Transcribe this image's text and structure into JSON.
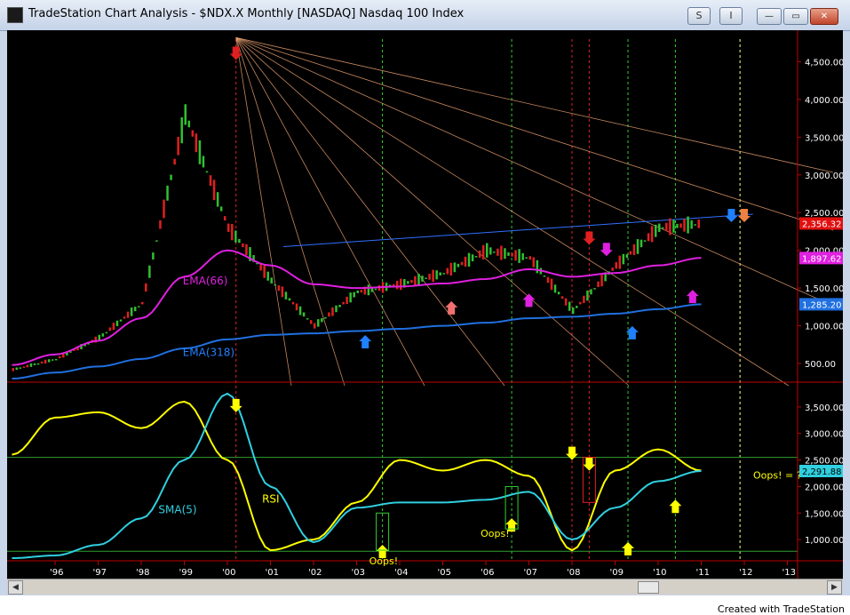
{
  "window": {
    "title": "TradeStation Chart Analysis - $NDX.X Monthly [NASDAQ] Nasdaq 100 Index",
    "s_button": "S",
    "i_button": "I",
    "minimize": "—",
    "maximize": "▭",
    "close": "✕"
  },
  "price_panel": {
    "y_ticks": [
      "4,500.00",
      "4,000.00",
      "3,500.00",
      "3,000.00",
      "2,500.00",
      "2,000.00",
      "1,500.00",
      "1,000.00",
      "500.00"
    ],
    "badges": [
      {
        "label": "2,356.32",
        "color": "#e01010"
      },
      {
        "label": "1,897.62",
        "color": "#e020e0"
      },
      {
        "label": "1,285.20",
        "color": "#2070e0"
      }
    ],
    "ema66_label": "EMA(66)",
    "ema318_label": "EMA(318)"
  },
  "indicator_panel": {
    "y_ticks": [
      "3,500.00",
      "3,000.00",
      "2,500.00",
      "2,000.00",
      "1,500.00",
      "1,000.00"
    ],
    "badge": {
      "label": "2,291.88",
      "color": "#30d0e0"
    },
    "rsi_label": "RSI",
    "sma_label": "SMA(5)",
    "annotations": [
      "Oops!",
      "Oops!",
      "Oops! = ?"
    ]
  },
  "x_axis": {
    "labels": [
      "'96",
      "'97",
      "'98",
      "'99",
      "'00",
      "'01",
      "'02",
      "'03",
      "'04",
      "'05",
      "'06",
      "'07",
      "'08",
      "'09",
      "'10",
      "'11",
      "'12",
      "'13"
    ]
  },
  "chart_data": {
    "type": "line",
    "instrument": "$NDX.X",
    "interval": "Monthly",
    "price_axis_range": [
      300,
      4800
    ],
    "x": [
      "'96",
      "'97",
      "'98",
      "'99",
      "'00",
      "'01",
      "'02",
      "'03",
      "'04",
      "'05",
      "'06",
      "'07",
      "'08",
      "'09",
      "'10",
      "'11",
      "'12"
    ],
    "series": [
      {
        "name": "EMA(66)",
        "color": "#e020e0",
        "values": [
          480,
          620,
          800,
          1100,
          1650,
          2000,
          1800,
          1550,
          1500,
          1520,
          1560,
          1620,
          1750,
          1650,
          1700,
          1800,
          1900
        ]
      },
      {
        "name": "EMA(318)",
        "color": "#2070e0",
        "values": [
          300,
          380,
          460,
          560,
          700,
          820,
          880,
          900,
          930,
          960,
          1000,
          1040,
          1100,
          1120,
          1160,
          1220,
          1285
        ]
      },
      {
        "name": "Price",
        "color": "#30c030",
        "values": [
          420,
          560,
          840,
          1300,
          3800,
          2300,
          1600,
          1000,
          1450,
          1550,
          1700,
          2000,
          1900,
          1200,
          1800,
          2300,
          2356
        ]
      }
    ],
    "indicator": {
      "axis_range": [
        600,
        3900
      ],
      "series": [
        {
          "name": "RSI",
          "color": "#ffff00",
          "values": [
            2600,
            3300,
            3400,
            3100,
            3600,
            2500,
            800,
            1000,
            1700,
            2500,
            2300,
            2500,
            2200,
            800,
            2300,
            2700,
            2300
          ]
        },
        {
          "name": "SMA(5)",
          "color": "#30d0e0",
          "values": [
            650,
            700,
            900,
            1400,
            2500,
            3750,
            2000,
            950,
            1600,
            1700,
            1700,
            1750,
            1900,
            1000,
            1600,
            2100,
            2292
          ]
        }
      ]
    }
  },
  "footer_text": "Created with TradeStation"
}
